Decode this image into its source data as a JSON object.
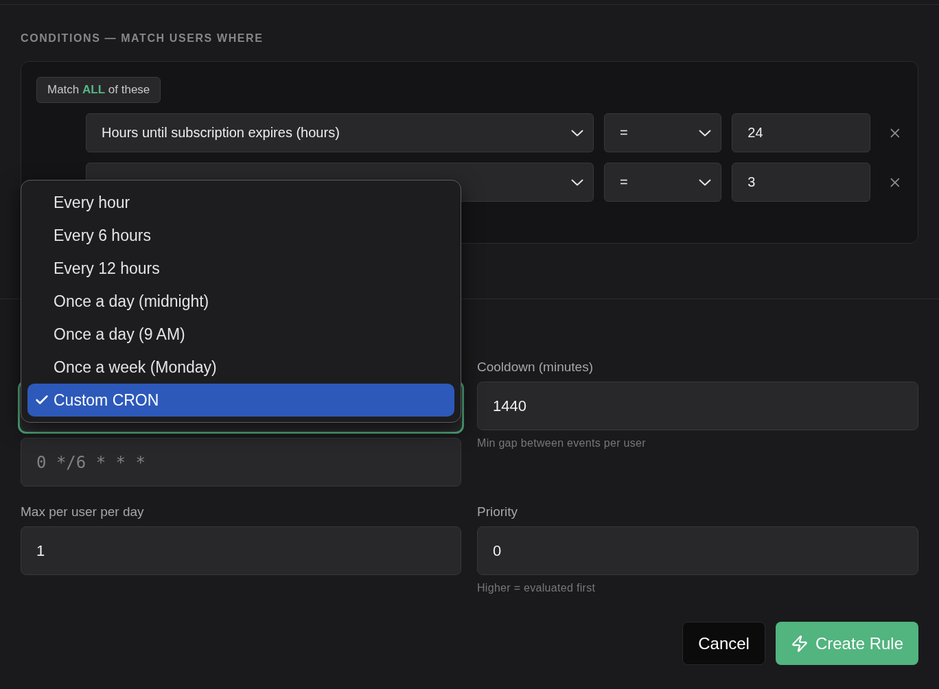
{
  "section_title": "CONDITIONS — MATCH USERS WHERE",
  "match_badge": "Match **ALL** of these",
  "conditions": [
    {
      "field": "Hours until subscription expires (hours)",
      "operator": "=",
      "value": "24"
    },
    {
      "operator": "=",
      "value": "3"
    }
  ],
  "schedule_select": {
    "focused": true
  },
  "schedule_menu": {
    "options": [
      {
        "label": "Every hour",
        "selected": false
      },
      {
        "label": "Every 6 hours",
        "selected": false
      },
      {
        "label": "Every 12 hours",
        "selected": false
      },
      {
        "label": "Once a day (midnight)",
        "selected": false
      },
      {
        "label": "Once a day (9 AM)",
        "selected": false
      },
      {
        "label": "Once a week (Monday)",
        "selected": false
      },
      {
        "label": "Custom CRON",
        "selected": true
      }
    ]
  },
  "cron_field": {
    "placeholder": "0 */6 * * *"
  },
  "cooldown": {
    "label": "Cooldown (minutes)",
    "value": "1440",
    "hint": "Min gap between events per user"
  },
  "max_per_user": {
    "label": "Max per user per day",
    "value": "1"
  },
  "priority": {
    "label": "Priority",
    "value": "0",
    "hint": "Higher = evaluated first"
  },
  "buttons": {
    "cancel": "Cancel",
    "create": "Create Rule"
  }
}
